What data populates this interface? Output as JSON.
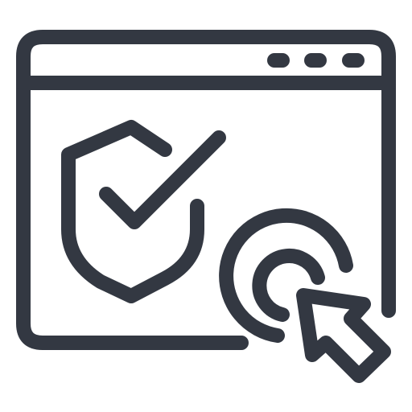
{
  "icon": {
    "name": "secure-website-click-icon",
    "stroke_color": "#333842",
    "background_color": "#ffffff",
    "parts": {
      "window": "browser-window-icon",
      "title_bar_dots": "window-control-dots-icon",
      "shield": "shield-icon",
      "checkmark": "checkmark-icon",
      "click_ripple": "click-ripple-icon",
      "cursor": "cursor-arrow-icon"
    }
  }
}
